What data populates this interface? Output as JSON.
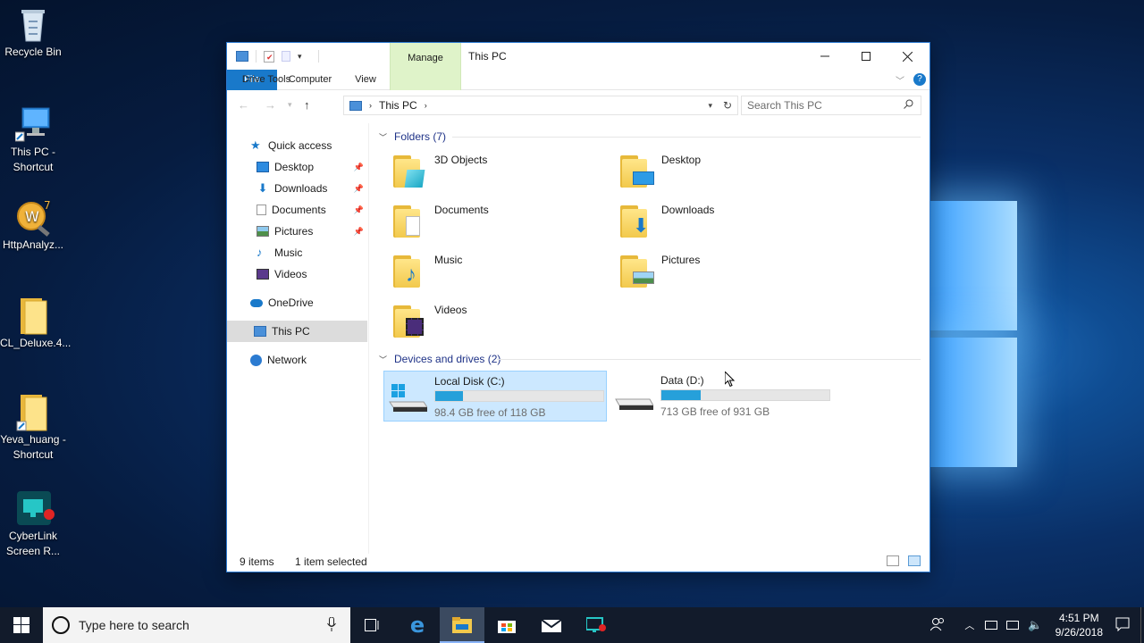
{
  "desktop": {
    "icons": [
      {
        "label": "Recycle Bin",
        "icon": "recycle-bin-icon"
      },
      {
        "label": "This PC - Shortcut",
        "icon": "computer-icon"
      },
      {
        "label": "HttpAnalyz...",
        "icon": "http-analyzer-icon"
      },
      {
        "label": "CL_Deluxe.4...",
        "icon": "folder-icon"
      },
      {
        "label": "Yeva_huang - Shortcut",
        "icon": "folder-icon"
      },
      {
        "label": "CyberLink Screen R...",
        "icon": "screen-recorder-icon"
      }
    ]
  },
  "window": {
    "title": "This PC",
    "contextual_tab_group": "Manage",
    "ribbon_tabs": [
      "File",
      "Computer",
      "View",
      "Drive Tools"
    ],
    "address": {
      "location": "This PC"
    },
    "search_placeholder": "Search This PC",
    "nav": {
      "quick_access": "Quick access",
      "quick_items": [
        {
          "label": "Desktop",
          "pinned": true
        },
        {
          "label": "Downloads",
          "pinned": true
        },
        {
          "label": "Documents",
          "pinned": true
        },
        {
          "label": "Pictures",
          "pinned": true
        },
        {
          "label": "Music",
          "pinned": false
        },
        {
          "label": "Videos",
          "pinned": false
        }
      ],
      "onedrive": "OneDrive",
      "this_pc": "This PC",
      "network": "Network"
    },
    "folders_group": "Folders (7)",
    "folders": [
      "3D Objects",
      "Desktop",
      "Documents",
      "Downloads",
      "Music",
      "Pictures",
      "Videos"
    ],
    "devices_group": "Devices and drives (2)",
    "drives": [
      {
        "name": "Local Disk (C:)",
        "free_text": "98.4 GB free of 118 GB",
        "used_fraction": 0.166,
        "selected": true
      },
      {
        "name": "Data (D:)",
        "free_text": "713 GB free of 931 GB",
        "used_fraction": 0.234,
        "selected": false
      }
    ],
    "status": {
      "items": "9 items",
      "selection": "1 item selected"
    }
  },
  "taskbar": {
    "search_placeholder": "Type here to search",
    "time": "4:51 PM",
    "date": "9/26/2018"
  },
  "colors": {
    "accent": "#1979ca",
    "manage_tab": "#dff3c9",
    "drive_bar": "#26a0da",
    "selection": "#cce8ff"
  }
}
